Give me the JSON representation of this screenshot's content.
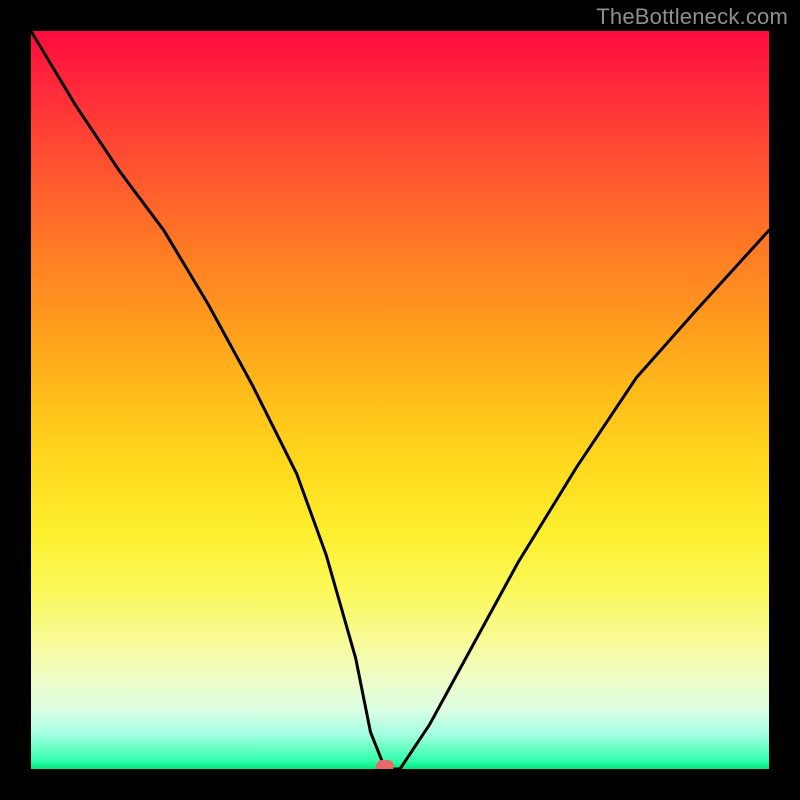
{
  "watermark": "TheBottleneck.com",
  "chart_data": {
    "type": "line",
    "title": "",
    "xlabel": "",
    "ylabel": "",
    "xlim": [
      0,
      100
    ],
    "ylim": [
      0,
      100
    ],
    "annotations": {
      "marker": {
        "x": 48,
        "y": 0
      },
      "background": "vertical gradient red→orange→yellow→green (high to low bottleneck)"
    },
    "series": [
      {
        "name": "bottleneck-curve",
        "x": [
          0,
          6,
          12,
          18,
          24,
          30,
          36,
          40,
          44,
          46,
          48,
          50,
          54,
          60,
          66,
          74,
          82,
          90,
          100
        ],
        "y": [
          100,
          90,
          81,
          73,
          63,
          52,
          40,
          29,
          15,
          5,
          0,
          0,
          6,
          17,
          28,
          41,
          53,
          62,
          73
        ]
      }
    ]
  }
}
